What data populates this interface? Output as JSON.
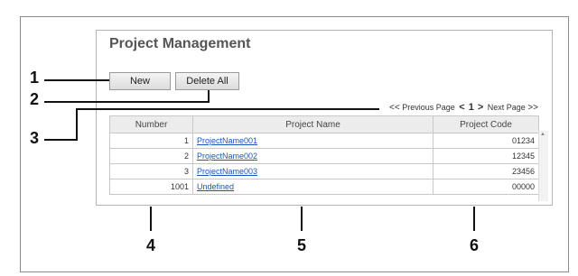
{
  "page": {
    "title": "Project Management"
  },
  "toolbar": {
    "new_label": "New",
    "delete_all_label": "Delete All"
  },
  "pager": {
    "prev_arrows": "<<",
    "prev_label": "Previous Page",
    "left_arrow": "<",
    "current_page": "1",
    "right_arrow": ">",
    "next_label": "Next Page",
    "next_arrows": ">>"
  },
  "table": {
    "headers": [
      "Number",
      "Project Name",
      "Project Code"
    ],
    "rows": [
      {
        "number": "1",
        "name": "ProjectName001",
        "code": "01234"
      },
      {
        "number": "2",
        "name": "ProjectName002",
        "code": "12345"
      },
      {
        "number": "3",
        "name": "ProjectName003",
        "code": "23456"
      },
      {
        "number": "1001",
        "name": "Undefined",
        "code": "00000"
      }
    ]
  },
  "callouts": [
    "1",
    "2",
    "3",
    "4",
    "5",
    "6"
  ]
}
